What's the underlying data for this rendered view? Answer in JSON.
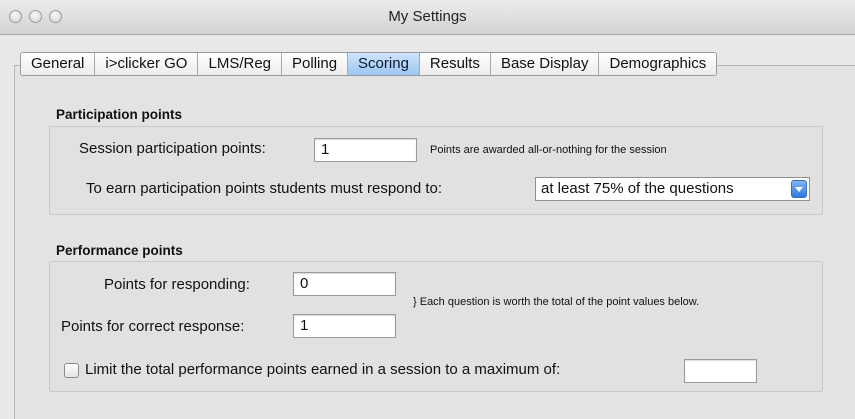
{
  "window": {
    "title": "My Settings"
  },
  "tabs": [
    {
      "label": "General"
    },
    {
      "label": "i>clicker GO"
    },
    {
      "label": "LMS/Reg"
    },
    {
      "label": "Polling"
    },
    {
      "label": "Scoring",
      "active": true
    },
    {
      "label": "Results"
    },
    {
      "label": "Base Display"
    },
    {
      "label": "Demographics"
    }
  ],
  "participation": {
    "heading": "Participation points",
    "session_label": "Session participation points:",
    "session_value": "1",
    "session_note": "Points are awarded all-or-nothing for the session",
    "respond_label": "To earn participation points students must respond to:",
    "respond_selected": "at least 75% of the questions"
  },
  "performance": {
    "heading": "Performance points",
    "responding_label": "Points for responding:",
    "responding_value": "0",
    "correct_label": "Points for correct response:",
    "correct_value": "1",
    "note": "} Each question is worth the total of the point values below.",
    "limit_label": "Limit the total performance points earned in a session to a maximum of:",
    "limit_checked": false,
    "limit_value": ""
  }
}
